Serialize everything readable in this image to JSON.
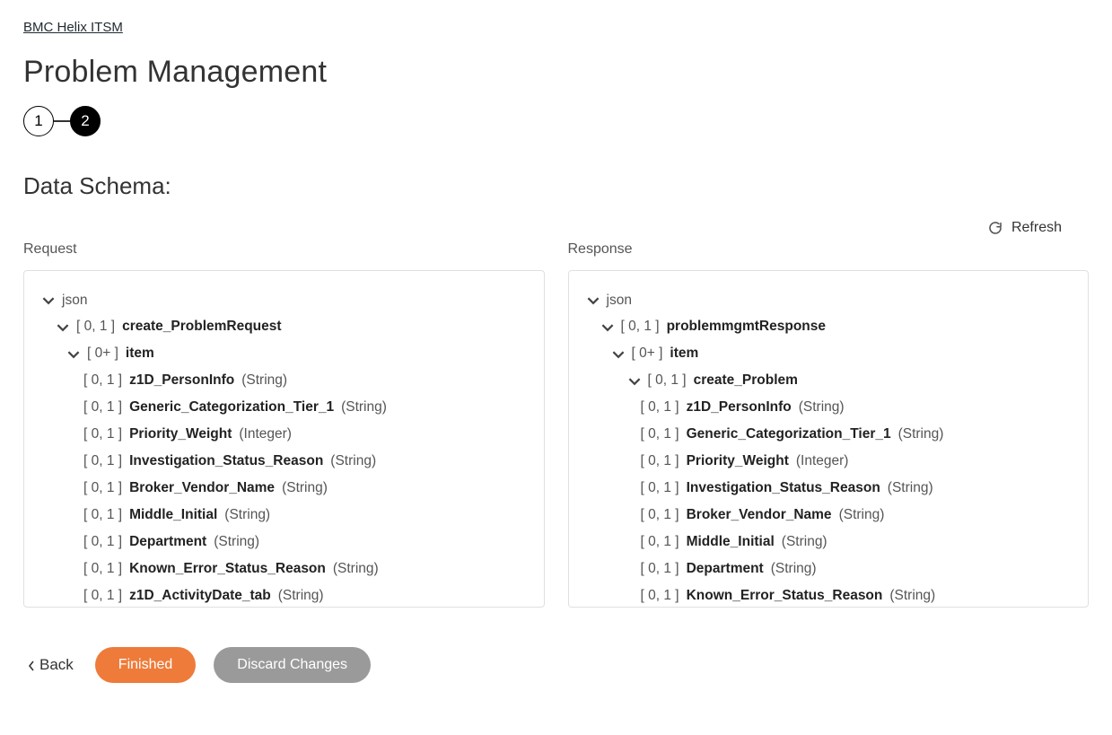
{
  "breadcrumb": "BMC Helix ITSM",
  "page_title": "Problem Management",
  "stepper": {
    "step1": "1",
    "step2": "2"
  },
  "section_heading": "Data Schema:",
  "refresh_label": "Refresh",
  "request_title": "Request",
  "response_title": "Response",
  "footer": {
    "back": "Back",
    "finished": "Finished",
    "discard": "Discard Changes"
  },
  "card_labels": {
    "c01": "[ 0, 1 ]",
    "c0p": "[ 0+ ]"
  },
  "request_tree": {
    "root": "json",
    "l1_name": "create_ProblemRequest",
    "l2_name": "item",
    "leaves": [
      {
        "name": "z1D_PersonInfo",
        "type": "(String)"
      },
      {
        "name": "Generic_Categorization_Tier_1",
        "type": "(String)"
      },
      {
        "name": "Priority_Weight",
        "type": "(Integer)"
      },
      {
        "name": "Investigation_Status_Reason",
        "type": "(String)"
      },
      {
        "name": "Broker_Vendor_Name",
        "type": "(String)"
      },
      {
        "name": "Middle_Initial",
        "type": "(String)"
      },
      {
        "name": "Department",
        "type": "(String)"
      },
      {
        "name": "Known_Error_Status_Reason",
        "type": "(String)"
      },
      {
        "name": "z1D_ActivityDate_tab",
        "type": "(String)"
      }
    ]
  },
  "response_tree": {
    "root": "json",
    "l1_name": "problemmgmtResponse",
    "l2_name": "item",
    "l3_name": "create_Problem",
    "leaves": [
      {
        "name": "z1D_PersonInfo",
        "type": "(String)"
      },
      {
        "name": "Generic_Categorization_Tier_1",
        "type": "(String)"
      },
      {
        "name": "Priority_Weight",
        "type": "(Integer)"
      },
      {
        "name": "Investigation_Status_Reason",
        "type": "(String)"
      },
      {
        "name": "Broker_Vendor_Name",
        "type": "(String)"
      },
      {
        "name": "Middle_Initial",
        "type": "(String)"
      },
      {
        "name": "Department",
        "type": "(String)"
      },
      {
        "name": "Known_Error_Status_Reason",
        "type": "(String)"
      }
    ]
  }
}
